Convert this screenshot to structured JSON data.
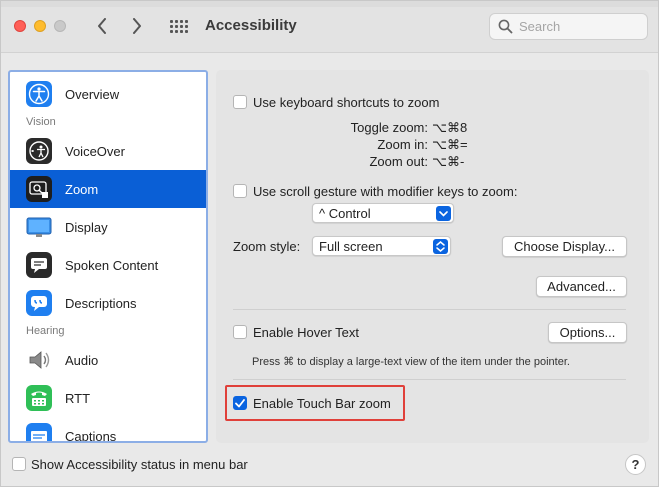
{
  "window": {
    "title": "Accessibility",
    "search_placeholder": "Search"
  },
  "sidebar": {
    "items": [
      {
        "label": "Overview"
      },
      {
        "label": "VoiceOver"
      },
      {
        "label": "Zoom",
        "selected": true
      },
      {
        "label": "Display"
      },
      {
        "label": "Spoken Content"
      },
      {
        "label": "Descriptions"
      },
      {
        "label": "Audio"
      },
      {
        "label": "RTT"
      },
      {
        "label": "Captions"
      }
    ],
    "headings": {
      "vision": "Vision",
      "hearing": "Hearing"
    }
  },
  "zoom": {
    "keyboard_shortcuts": {
      "label": "Use keyboard shortcuts to zoom",
      "checked": false,
      "toggle_label": "Toggle zoom:",
      "toggle_keys": "⌥⌘8",
      "in_label": "Zoom in:",
      "in_keys": "⌥⌘=",
      "out_label": "Zoom out:",
      "out_keys": "⌥⌘-"
    },
    "scroll_gesture": {
      "label": "Use scroll gesture with modifier keys to zoom:",
      "checked": false,
      "modifier_value": "^ Control"
    },
    "zoom_style": {
      "label": "Zoom style:",
      "value": "Full screen",
      "choose_display_button": "Choose Display..."
    },
    "advanced_button": "Advanced...",
    "hover_text": {
      "label": "Enable Hover Text",
      "checked": false,
      "options_button": "Options...",
      "hint": "Press ⌘ to display a large-text view of the item under the pointer."
    },
    "touch_bar_zoom": {
      "label": "Enable Touch Bar zoom",
      "checked": true
    }
  },
  "footer": {
    "status_label": "Show Accessibility status in menu bar",
    "status_checked": false,
    "help": "?"
  },
  "colors": {
    "accent": "#0a5fd6",
    "highlight_border": "#e0403a"
  }
}
